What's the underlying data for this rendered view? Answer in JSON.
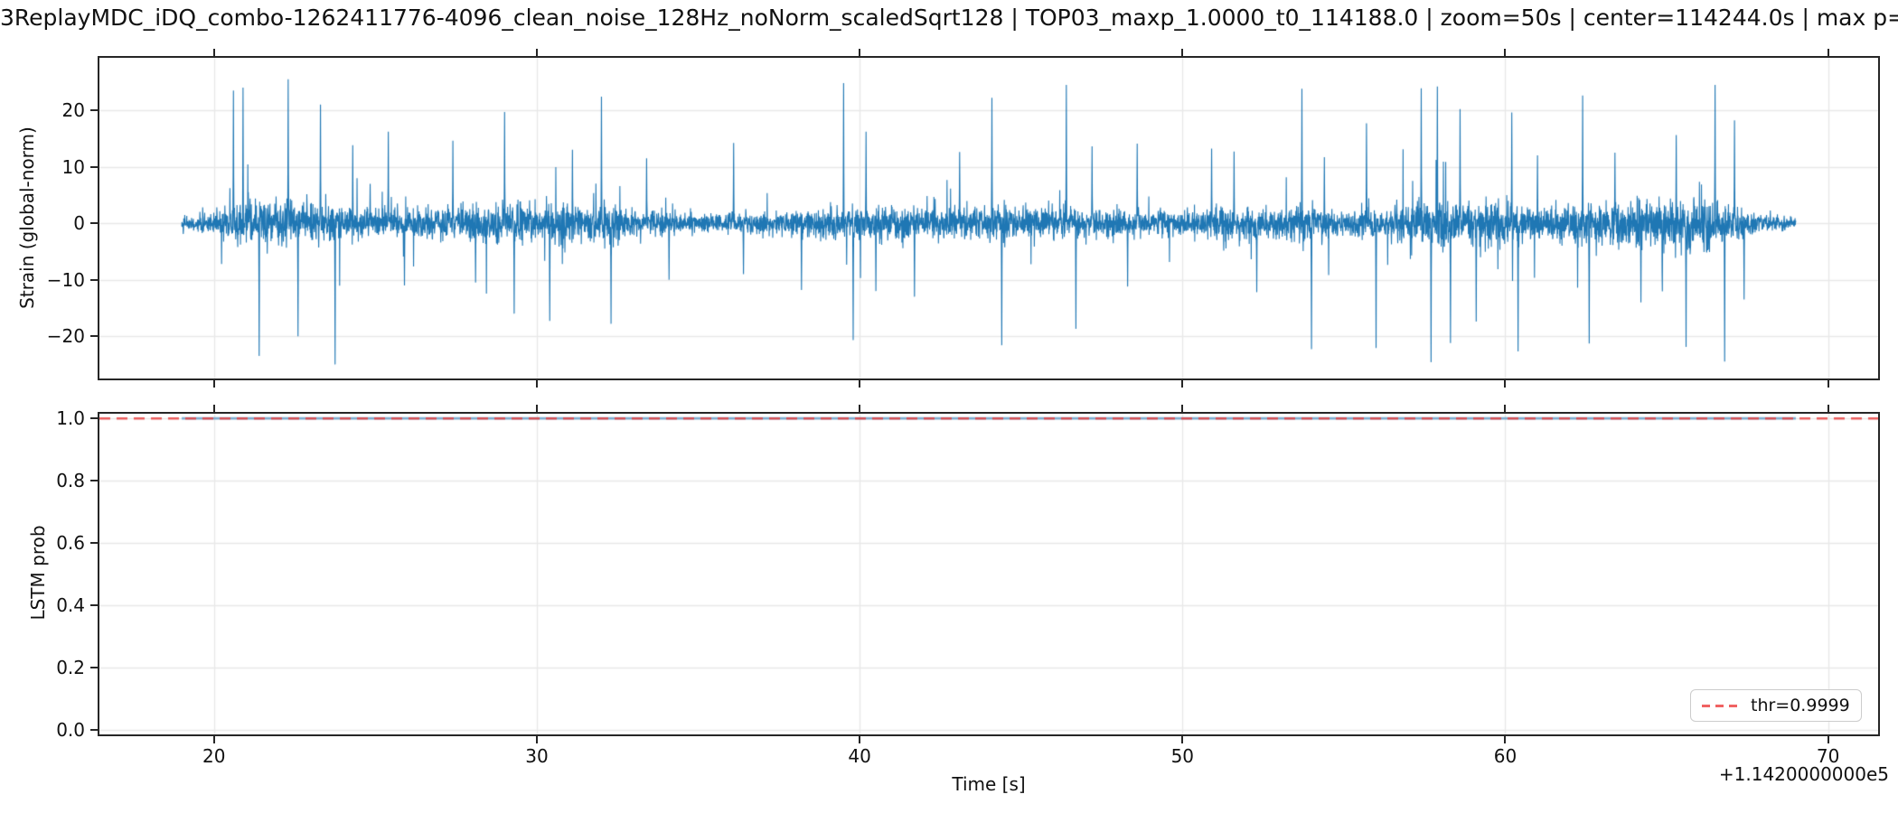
{
  "title": "3ReplayMDC_iDQ_combo-1262411776-4096_clean_noise_128Hz_noNorm_scaledSqrt128 | TOP03_maxp_1.0000_t0_114188.0 | zoom=50s | center=114244.0s | max p=",
  "figure": {
    "background": "#ffffff",
    "spine_color": "#262626",
    "grid_color": "#e8e8e8",
    "tick_color": "#262626"
  },
  "xaxis": {
    "label": "Time [s]",
    "offset_text": "+1.1420000000e5",
    "ticks": [
      20,
      30,
      40,
      50,
      60,
      70
    ],
    "xlim": [
      16.45,
      71.55
    ]
  },
  "chart_data": [
    {
      "type": "line",
      "ylabel": "Strain (global-norm)",
      "ylim": [
        -27.5,
        29.3
      ],
      "yticks": [
        -20,
        -10,
        0,
        10,
        20
      ],
      "grid": true,
      "series": [
        {
          "name": "strain",
          "color": "#1f77b4",
          "t_start": 19.0,
          "t_end": 69.0,
          "sample_rate_hz": 128,
          "description": "whitened noise strain, sigma~1.5 with impulsive glitches up to +/-25",
          "noise_model": {
            "seed": 42,
            "n_samples": 6400,
            "envelope": [
              [
                19.0,
                0.55
              ],
              [
                19.5,
                0.8
              ],
              [
                20.0,
                1.1
              ],
              [
                20.5,
                1.6
              ],
              [
                21.0,
                1.9
              ],
              [
                21.5,
                2.0
              ],
              [
                22.0,
                2.1
              ],
              [
                22.5,
                1.9
              ],
              [
                23.0,
                1.9
              ],
              [
                23.5,
                1.8
              ],
              [
                24.0,
                1.6
              ],
              [
                24.5,
                1.4
              ],
              [
                25.0,
                1.3
              ],
              [
                26.0,
                1.4
              ],
              [
                27.0,
                1.5
              ],
              [
                28.0,
                1.7
              ],
              [
                29.0,
                1.8
              ],
              [
                30.0,
                1.6
              ],
              [
                31.0,
                1.7
              ],
              [
                32.0,
                1.6
              ],
              [
                33.0,
                1.3
              ],
              [
                34.0,
                1.0
              ],
              [
                34.5,
                0.85
              ],
              [
                35.0,
                0.8
              ],
              [
                36.0,
                0.8
              ],
              [
                37.0,
                0.9
              ],
              [
                38.0,
                1.05
              ],
              [
                39.0,
                1.3
              ],
              [
                40.0,
                1.5
              ],
              [
                41.0,
                1.45
              ],
              [
                42.0,
                1.35
              ],
              [
                43.0,
                1.4
              ],
              [
                44.0,
                1.45
              ],
              [
                45.0,
                1.3
              ],
              [
                46.0,
                1.35
              ],
              [
                47.0,
                1.25
              ],
              [
                48.0,
                1.15
              ],
              [
                49.0,
                1.05
              ],
              [
                50.0,
                1.15
              ],
              [
                51.0,
                1.45
              ],
              [
                52.0,
                1.5
              ],
              [
                53.0,
                1.45
              ],
              [
                54.0,
                1.5
              ],
              [
                55.0,
                1.35
              ],
              [
                56.0,
                1.3
              ],
              [
                57.0,
                1.8
              ],
              [
                58.0,
                2.3
              ],
              [
                58.5,
                2.4
              ],
              [
                59.0,
                2.1
              ],
              [
                60.0,
                1.8
              ],
              [
                61.0,
                1.5
              ],
              [
                62.0,
                1.6
              ],
              [
                63.0,
                1.8
              ],
              [
                64.0,
                2.0
              ],
              [
                65.0,
                2.3
              ],
              [
                66.0,
                2.1
              ],
              [
                66.5,
                2.2
              ],
              [
                67.0,
                1.6
              ],
              [
                67.8,
                1.1
              ],
              [
                68.3,
                0.8
              ],
              [
                68.8,
                0.55
              ],
              [
                69.0,
                0.45
              ]
            ],
            "spikes": [
              [
                20.6,
                23.5
              ],
              [
                20.9,
                24.0
              ],
              [
                21.4,
                -23.5
              ],
              [
                22.3,
                25.5
              ],
              [
                22.6,
                -20.0
              ],
              [
                23.3,
                21.0
              ],
              [
                23.75,
                -25.0
              ],
              [
                24.3,
                13.8
              ],
              [
                25.4,
                16.2
              ],
              [
                25.9,
                -11.0
              ],
              [
                27.4,
                14.6
              ],
              [
                28.1,
                -10.5
              ],
              [
                29.0,
                19.7
              ],
              [
                29.3,
                -16.0
              ],
              [
                30.4,
                -17.3
              ],
              [
                31.1,
                13.0
              ],
              [
                32.0,
                22.4
              ],
              [
                32.3,
                -17.8
              ],
              [
                33.4,
                11.5
              ],
              [
                34.1,
                -10.0
              ],
              [
                36.1,
                14.2
              ],
              [
                36.4,
                -9.0
              ],
              [
                38.2,
                -11.8
              ],
              [
                39.5,
                24.8
              ],
              [
                39.8,
                -20.7
              ],
              [
                40.2,
                16.2
              ],
              [
                40.5,
                -12.0
              ],
              [
                41.7,
                -13.0
              ],
              [
                43.1,
                12.6
              ],
              [
                44.1,
                22.2
              ],
              [
                44.4,
                -21.6
              ],
              [
                46.4,
                24.5
              ],
              [
                46.7,
                -18.7
              ],
              [
                47.2,
                13.6
              ],
              [
                48.3,
                -11.2
              ],
              [
                48.6,
                14.1
              ],
              [
                50.9,
                13.2
              ],
              [
                51.6,
                12.7
              ],
              [
                52.3,
                -12.2
              ],
              [
                53.7,
                23.8
              ],
              [
                54.0,
                -22.3
              ],
              [
                54.4,
                11.7
              ],
              [
                55.7,
                17.7
              ],
              [
                56.0,
                -22.1
              ],
              [
                57.4,
                23.9
              ],
              [
                57.7,
                -24.6
              ],
              [
                57.9,
                24.2
              ],
              [
                58.3,
                -21.2
              ],
              [
                58.6,
                20.2
              ],
              [
                59.1,
                -17.4
              ],
              [
                60.2,
                19.6
              ],
              [
                60.4,
                -22.7
              ],
              [
                61.0,
                12.0
              ],
              [
                62.4,
                22.6
              ],
              [
                62.6,
                -21.3
              ],
              [
                63.4,
                12.5
              ],
              [
                64.2,
                -14.0
              ],
              [
                65.3,
                15.6
              ],
              [
                65.6,
                -21.9
              ],
              [
                66.5,
                24.5
              ],
              [
                66.8,
                -24.5
              ],
              [
                67.1,
                18.2
              ],
              [
                67.4,
                -13.5
              ]
            ],
            "random_spikes": {
              "rate": 0.012,
              "amp_min": 2.5,
              "amp_max": 9.0
            }
          }
        }
      ]
    },
    {
      "type": "line",
      "ylabel": "LSTM prob",
      "ylim": [
        -0.015,
        1.015
      ],
      "yticks": [
        0.0,
        0.2,
        0.4,
        0.6,
        0.8,
        1.0
      ],
      "grid": true,
      "series": [
        {
          "name": "lstm-probability",
          "color": "rgba(31,119,180,0.55)",
          "t_start": 19.0,
          "t_end": 69.0,
          "constant_value": 1.0,
          "description": "LSTM probability, constant at 1.0 across the whole window"
        }
      ],
      "threshold": {
        "value": 0.9999,
        "color": "rgba(232,55,55,0.8)",
        "dash": [
          12,
          7
        ]
      },
      "legend": {
        "label": "thr=0.9999",
        "position": "lower right"
      }
    }
  ]
}
